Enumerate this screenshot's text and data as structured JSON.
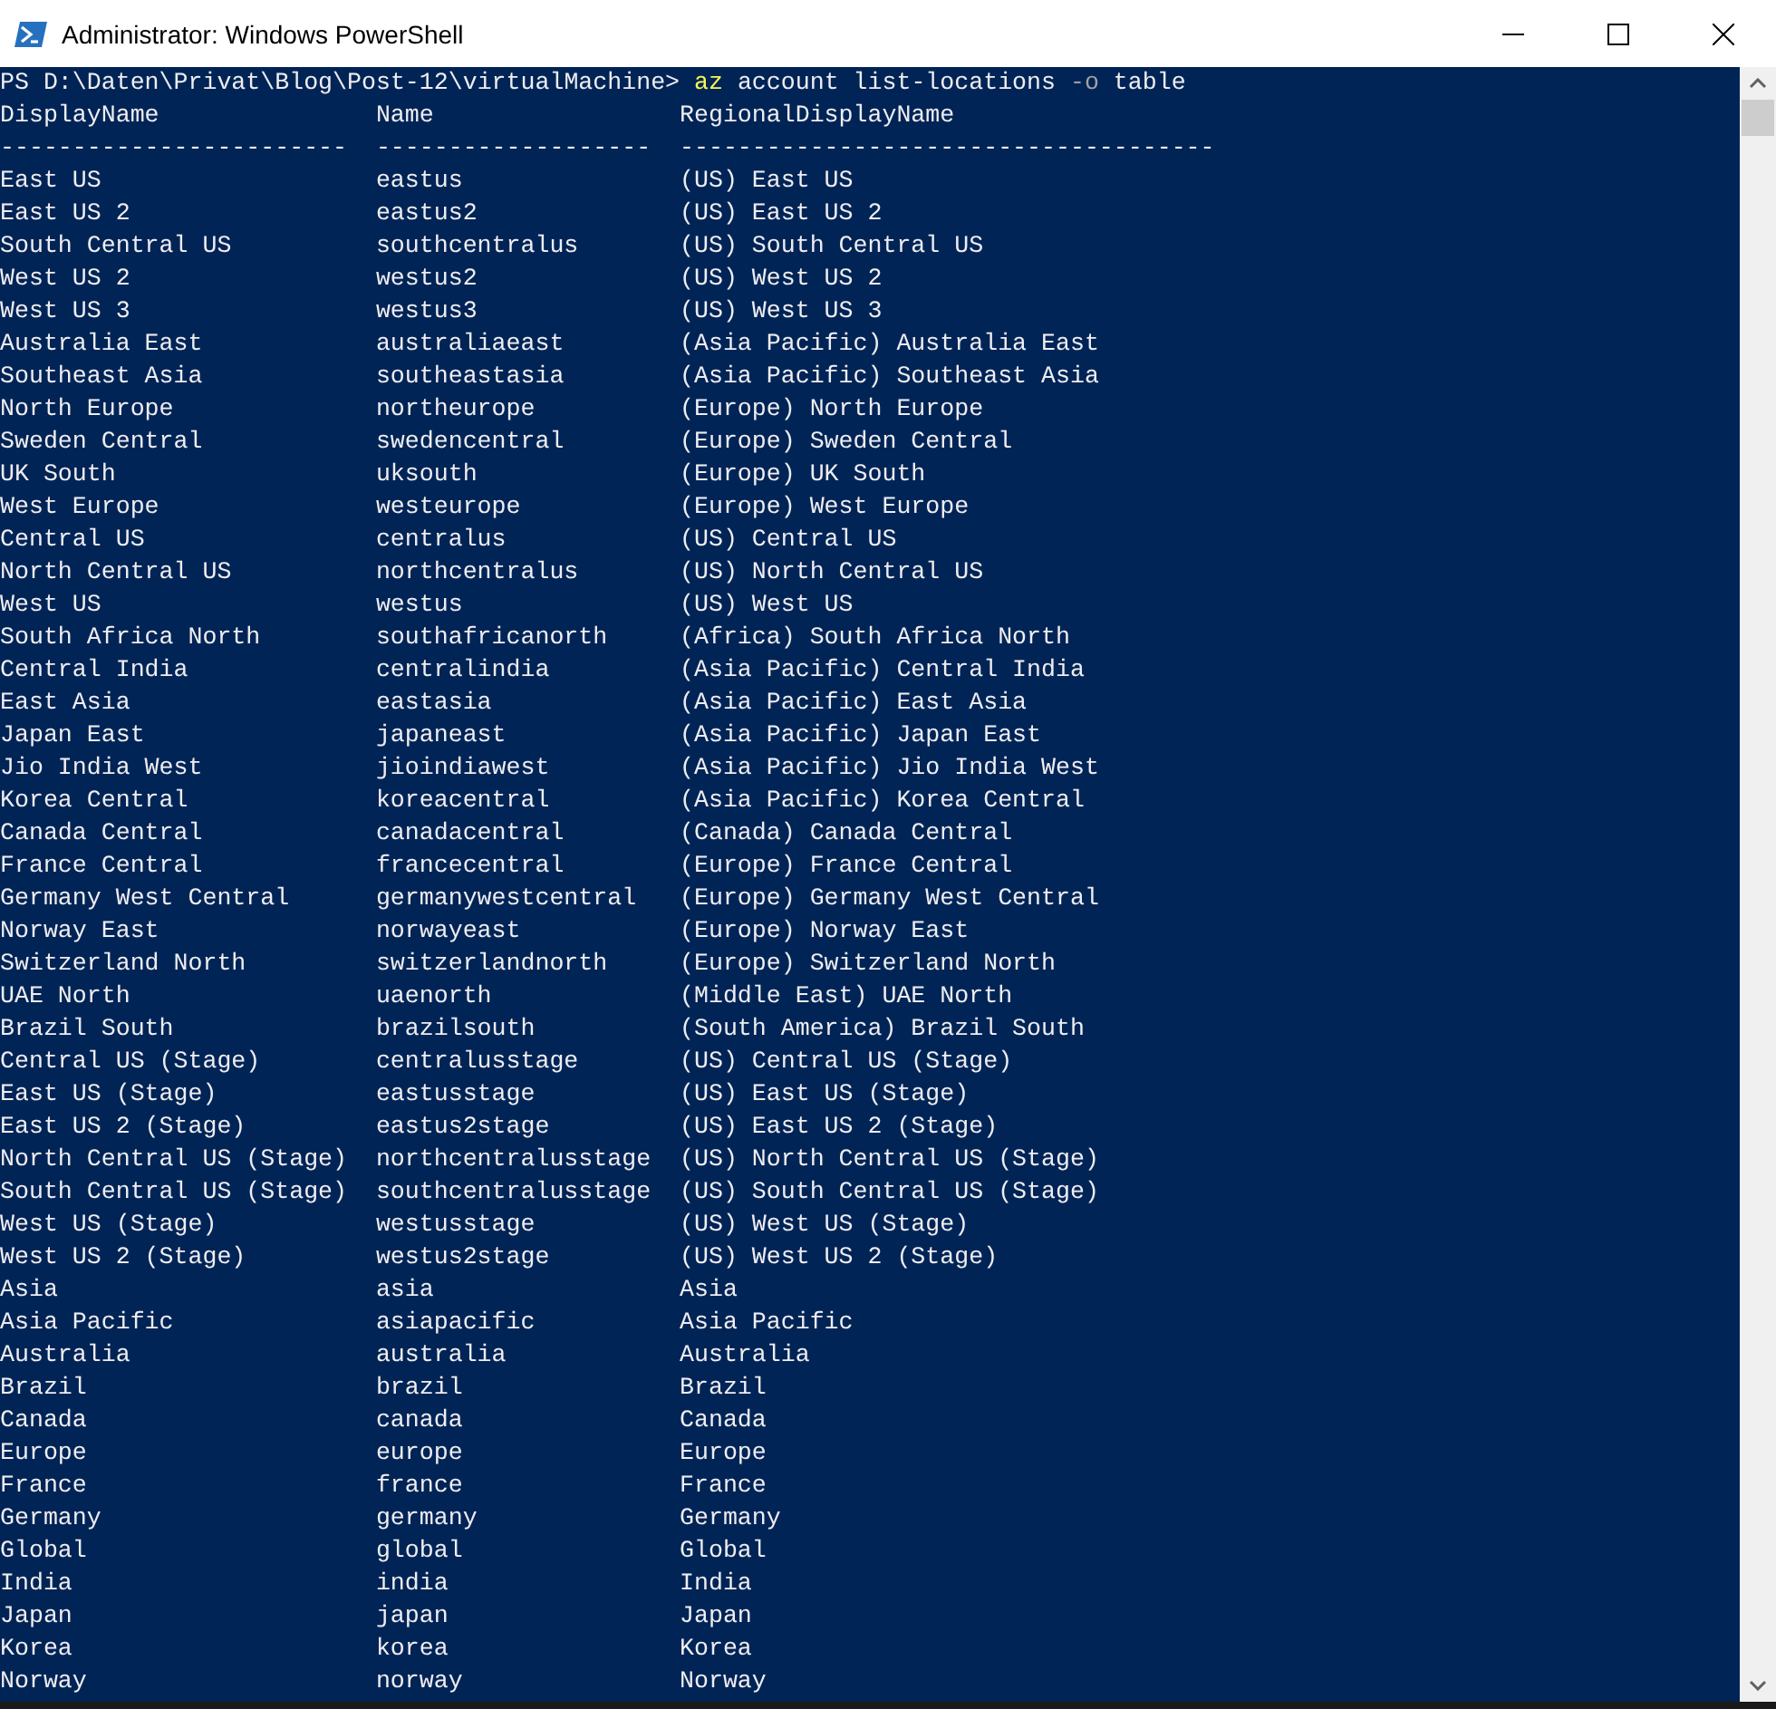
{
  "window": {
    "title": "Administrator: Windows PowerShell"
  },
  "prompt": "PS D:\\Daten\\Privat\\Blog\\Post-12\\virtualMachine>",
  "command": [
    {
      "text": "az",
      "kind": "command"
    },
    {
      "text": "account",
      "kind": "argument"
    },
    {
      "text": "list-locations",
      "kind": "argument"
    },
    {
      "text": "-o",
      "kind": "parameter"
    },
    {
      "text": "table",
      "kind": "argument"
    }
  ],
  "table": {
    "columns": [
      {
        "header": "DisplayName",
        "rule": "------------------------"
      },
      {
        "header": "Name",
        "rule": "-------------------"
      },
      {
        "header": "RegionalDisplayName",
        "rule": "-------------------------------------"
      }
    ],
    "rows": [
      [
        "East US",
        "eastus",
        "(US) East US"
      ],
      [
        "East US 2",
        "eastus2",
        "(US) East US 2"
      ],
      [
        "South Central US",
        "southcentralus",
        "(US) South Central US"
      ],
      [
        "West US 2",
        "westus2",
        "(US) West US 2"
      ],
      [
        "West US 3",
        "westus3",
        "(US) West US 3"
      ],
      [
        "Australia East",
        "australiaeast",
        "(Asia Pacific) Australia East"
      ],
      [
        "Southeast Asia",
        "southeastasia",
        "(Asia Pacific) Southeast Asia"
      ],
      [
        "North Europe",
        "northeurope",
        "(Europe) North Europe"
      ],
      [
        "Sweden Central",
        "swedencentral",
        "(Europe) Sweden Central"
      ],
      [
        "UK South",
        "uksouth",
        "(Europe) UK South"
      ],
      [
        "West Europe",
        "westeurope",
        "(Europe) West Europe"
      ],
      [
        "Central US",
        "centralus",
        "(US) Central US"
      ],
      [
        "North Central US",
        "northcentralus",
        "(US) North Central US"
      ],
      [
        "West US",
        "westus",
        "(US) West US"
      ],
      [
        "South Africa North",
        "southafricanorth",
        "(Africa) South Africa North"
      ],
      [
        "Central India",
        "centralindia",
        "(Asia Pacific) Central India"
      ],
      [
        "East Asia",
        "eastasia",
        "(Asia Pacific) East Asia"
      ],
      [
        "Japan East",
        "japaneast",
        "(Asia Pacific) Japan East"
      ],
      [
        "Jio India West",
        "jioindiawest",
        "(Asia Pacific) Jio India West"
      ],
      [
        "Korea Central",
        "koreacentral",
        "(Asia Pacific) Korea Central"
      ],
      [
        "Canada Central",
        "canadacentral",
        "(Canada) Canada Central"
      ],
      [
        "France Central",
        "francecentral",
        "(Europe) France Central"
      ],
      [
        "Germany West Central",
        "germanywestcentral",
        "(Europe) Germany West Central"
      ],
      [
        "Norway East",
        "norwayeast",
        "(Europe) Norway East"
      ],
      [
        "Switzerland North",
        "switzerlandnorth",
        "(Europe) Switzerland North"
      ],
      [
        "UAE North",
        "uaenorth",
        "(Middle East) UAE North"
      ],
      [
        "Brazil South",
        "brazilsouth",
        "(South America) Brazil South"
      ],
      [
        "Central US (Stage)",
        "centralusstage",
        "(US) Central US (Stage)"
      ],
      [
        "East US (Stage)",
        "eastusstage",
        "(US) East US (Stage)"
      ],
      [
        "East US 2 (Stage)",
        "eastus2stage",
        "(US) East US 2 (Stage)"
      ],
      [
        "North Central US (Stage)",
        "northcentralusstage",
        "(US) North Central US (Stage)"
      ],
      [
        "South Central US (Stage)",
        "southcentralusstage",
        "(US) South Central US (Stage)"
      ],
      [
        "West US (Stage)",
        "westusstage",
        "(US) West US (Stage)"
      ],
      [
        "West US 2 (Stage)",
        "westus2stage",
        "(US) West US 2 (Stage)"
      ],
      [
        "Asia",
        "asia",
        "Asia"
      ],
      [
        "Asia Pacific",
        "asiapacific",
        "Asia Pacific"
      ],
      [
        "Australia",
        "australia",
        "Australia"
      ],
      [
        "Brazil",
        "brazil",
        "Brazil"
      ],
      [
        "Canada",
        "canada",
        "Canada"
      ],
      [
        "Europe",
        "europe",
        "Europe"
      ],
      [
        "France",
        "france",
        "France"
      ],
      [
        "Germany",
        "germany",
        "Germany"
      ],
      [
        "Global",
        "global",
        "Global"
      ],
      [
        "India",
        "india",
        "India"
      ],
      [
        "Japan",
        "japan",
        "Japan"
      ],
      [
        "Korea",
        "korea",
        "Korea"
      ],
      [
        "Norway",
        "norway",
        "Norway"
      ]
    ]
  }
}
